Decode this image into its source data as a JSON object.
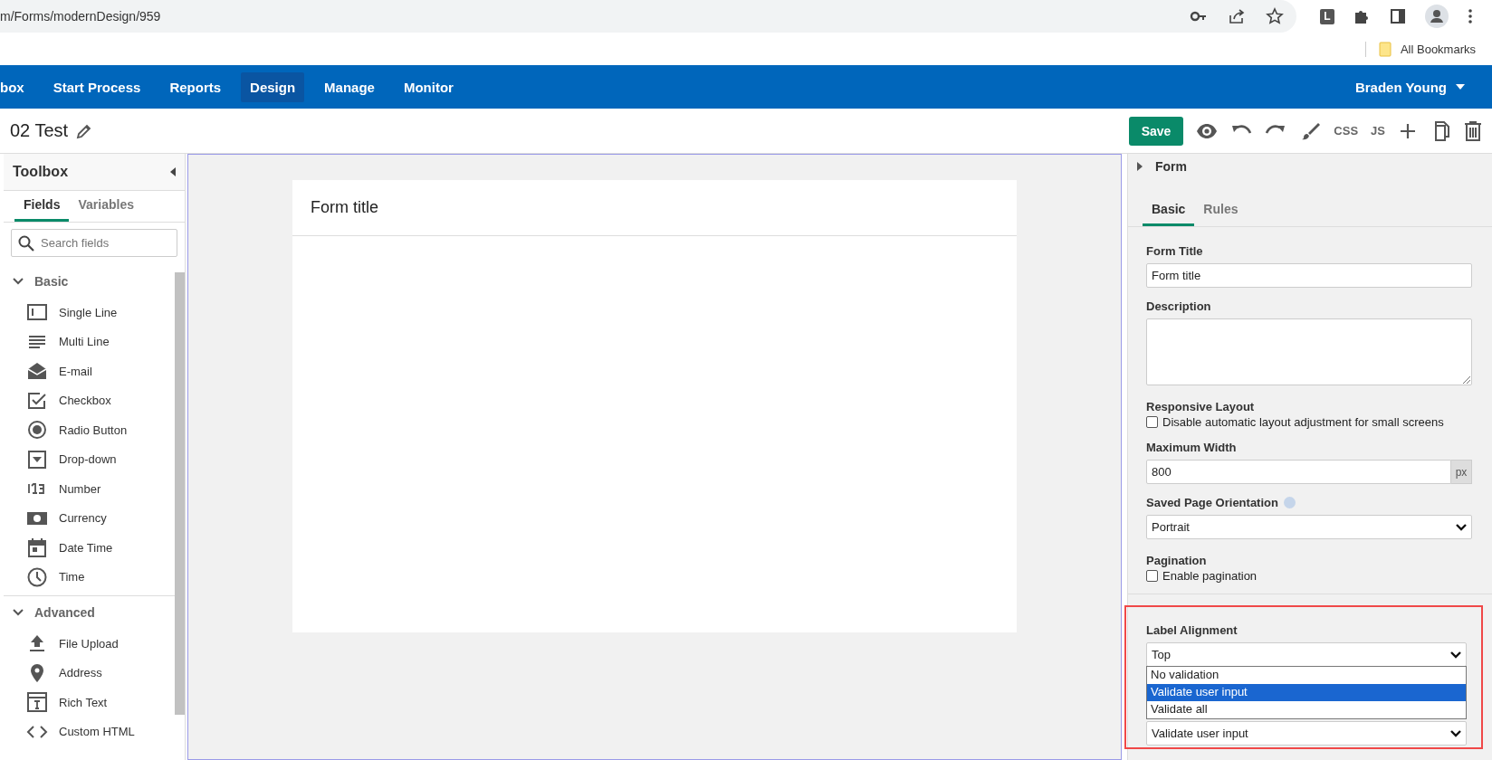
{
  "browser": {
    "url": "m/Forms/modernDesign/959",
    "extension_letter": "L",
    "bookmarks": [
      {
        "label": "All Bookmarks"
      }
    ]
  },
  "nav": {
    "items": [
      {
        "label": "box",
        "selected": false
      },
      {
        "label": "Start Process",
        "selected": false
      },
      {
        "label": "Reports",
        "selected": false
      },
      {
        "label": "Design",
        "selected": true
      },
      {
        "label": "Manage",
        "selected": false
      },
      {
        "label": "Monitor",
        "selected": false
      }
    ],
    "user": "Braden Young"
  },
  "header": {
    "title": "02 Test",
    "save": "Save",
    "css": "CSS",
    "js": "JS"
  },
  "toolbox": {
    "title": "Toolbox",
    "tabs": [
      {
        "label": "Fields",
        "selected": true
      },
      {
        "label": "Variables",
        "selected": false
      }
    ],
    "search": {
      "placeholder": "Search fields"
    },
    "groups": [
      {
        "label": "Basic",
        "expanded": true,
        "items": [
          {
            "label": "Single Line",
            "kind": "single_line"
          },
          {
            "label": "Multi Line",
            "kind": "multi_line"
          },
          {
            "label": "E-mail",
            "kind": "email"
          },
          {
            "label": "Checkbox",
            "kind": "checkbox"
          },
          {
            "label": "Radio Button",
            "kind": "radio"
          },
          {
            "label": "Drop-down",
            "kind": "dropdown"
          },
          {
            "label": "Number",
            "kind": "number"
          },
          {
            "label": "Currency",
            "kind": "currency"
          },
          {
            "label": "Date Time",
            "kind": "datetime"
          },
          {
            "label": "Time",
            "kind": "time"
          }
        ]
      },
      {
        "label": "Advanced",
        "expanded": true,
        "items": [
          {
            "label": "File Upload",
            "kind": "upload"
          },
          {
            "label": "Address",
            "kind": "address"
          },
          {
            "label": "Rich Text",
            "kind": "richtext"
          },
          {
            "label": "Custom HTML",
            "kind": "html"
          }
        ]
      }
    ]
  },
  "canvas": {
    "form_title": "Form title"
  },
  "properties": {
    "section": {
      "label": "Form",
      "expanded": false
    },
    "tabs": [
      {
        "label": "Basic",
        "selected": true
      },
      {
        "label": "Rules",
        "selected": false
      }
    ],
    "fields": [
      {
        "kind": "text",
        "label": "Form Title",
        "value": "Form title"
      },
      {
        "kind": "textarea",
        "label": "Description"
      },
      {
        "kind": "checkbox",
        "label": "Responsive Layout",
        "option": "Disable automatic layout adjustment for small screens",
        "checked": false
      },
      {
        "kind": "unit",
        "label": "Maximum Width",
        "value": "800",
        "unit": "px"
      },
      {
        "kind": "select",
        "label": "Saved Page Orientation",
        "value": "Portrait",
        "help": true
      },
      {
        "kind": "checkbox",
        "label": "Pagination",
        "option": "Enable pagination",
        "checked": false
      }
    ],
    "highlighted": {
      "label": "Label Alignment",
      "value": "Top",
      "options": [
        {
          "label": "No validation",
          "selected": false
        },
        {
          "label": "Validate user input",
          "selected": true
        },
        {
          "label": "Validate all",
          "selected": false
        }
      ],
      "next_value": "Validate user input"
    }
  }
}
